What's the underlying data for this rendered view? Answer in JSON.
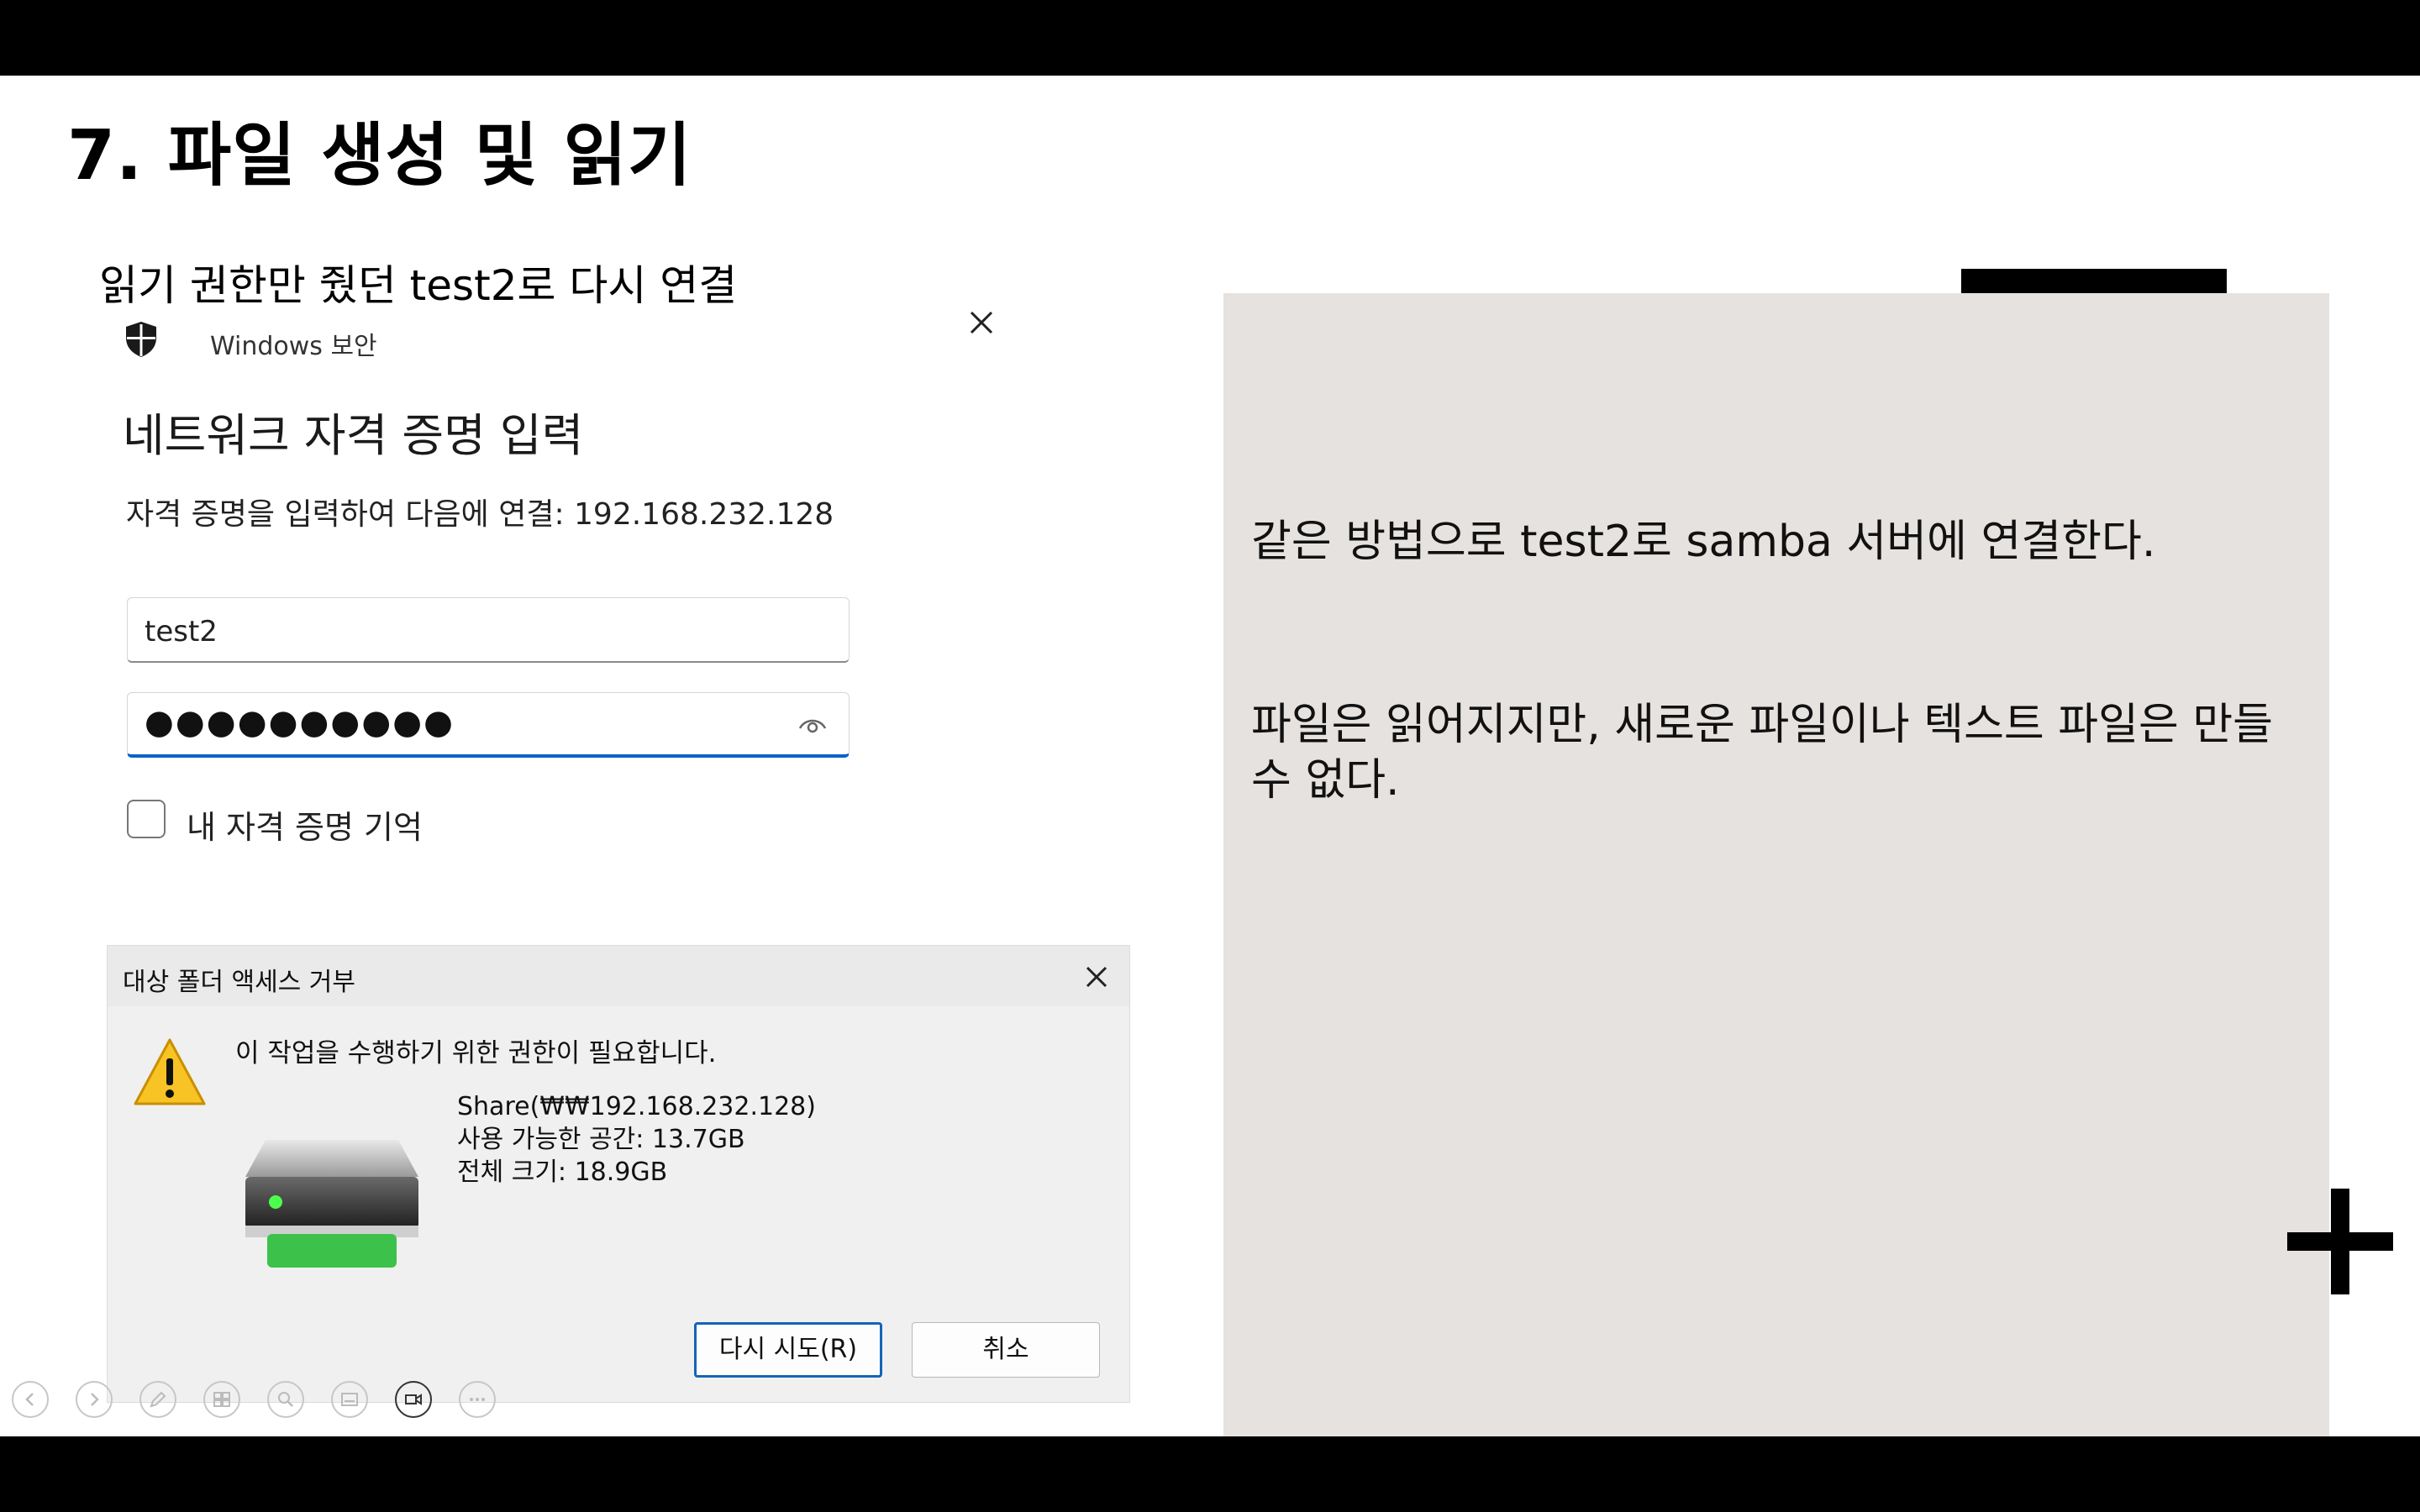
{
  "slide": {
    "title": "7. 파일 생성 및 읽기",
    "subtitle": "읽기 권한만 줬던 test2로 다시 연결"
  },
  "credential_dialog": {
    "app_name": "Windows 보안",
    "title": "네트워크 자격 증명 입력",
    "description": "자격 증명을 입력하여 다음에 연결: 192.168.232.128",
    "username_value": "test2",
    "password_mask": "●●●●●●●●●●",
    "remember_label": "내 자격 증명 기억",
    "remember_checked": false,
    "accent_color": "#0a63c4"
  },
  "access_dialog": {
    "title": "대상 폴더 액세스 거부",
    "message": "이 작업을 수행하기 위한 권한이 필요합니다.",
    "drive_name": "Share(₩₩192.168.232.128)",
    "free_space": "사용 가능한 공간: 13.7GB",
    "total_size": "전체 크기: 18.9GB",
    "retry_label": "다시 시도(R)",
    "cancel_label": "취소"
  },
  "toolbar": {
    "icons": [
      "prev-icon",
      "next-icon",
      "pen-icon",
      "slides-icon",
      "zoom-icon",
      "subtitles-icon",
      "camera-icon",
      "more-icon"
    ]
  },
  "panel": {
    "line1": "같은 방법으로 test2로 samba 서버에 연결한다.",
    "line2": "파일은 읽어지지만, 새로운 파일이나 텍스트 파일은 만들 수 없다.",
    "background": "#e6e2df"
  }
}
